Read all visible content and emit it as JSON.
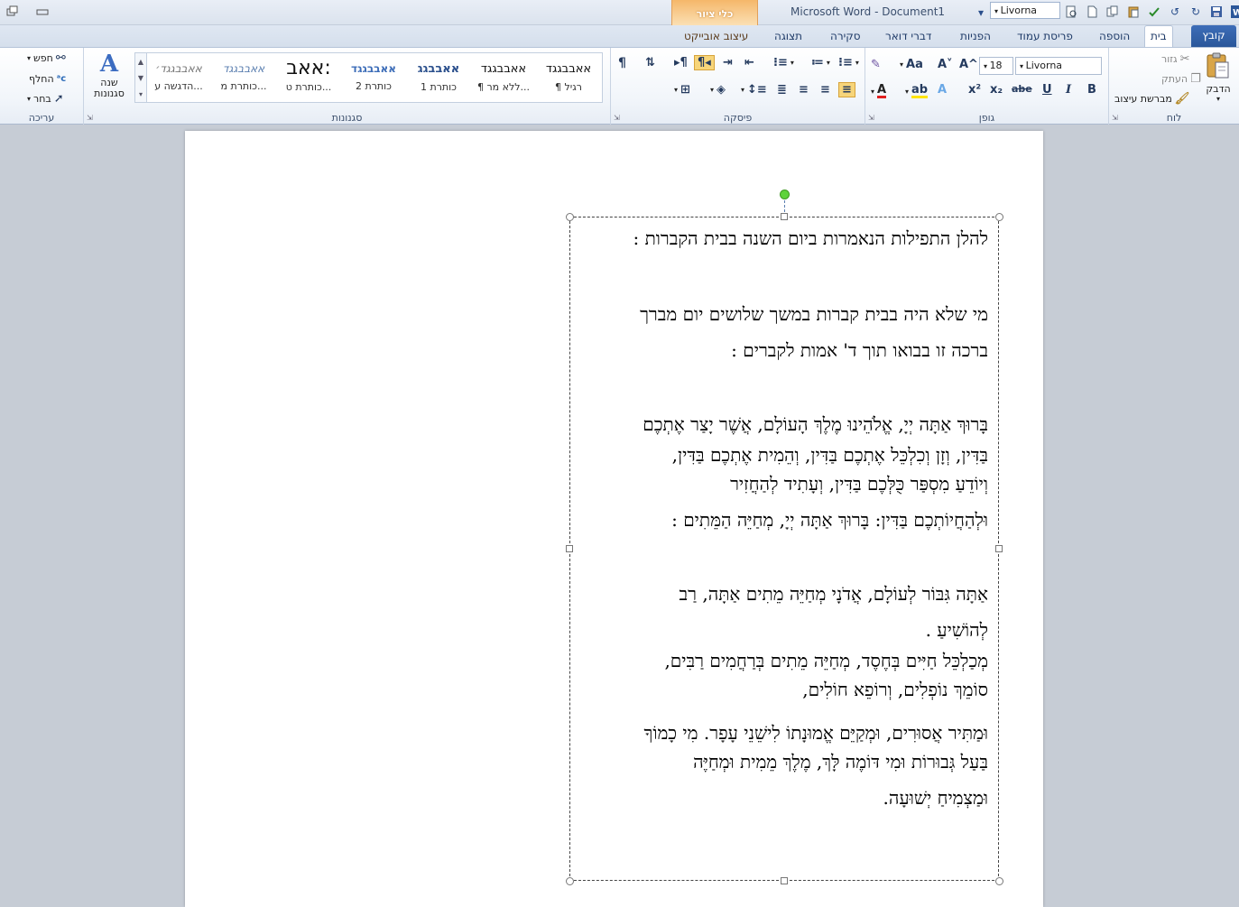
{
  "window": {
    "title": "Microsoft Word  -  Document1",
    "font_name_box": "Livorna",
    "contextual_tab_group": "כלי ציור"
  },
  "tabs": [
    {
      "label": "קובץ",
      "active": false
    },
    {
      "label": "בית",
      "active": true
    },
    {
      "label": "הוספה",
      "active": false
    },
    {
      "label": "פריסת עמוד",
      "active": false
    },
    {
      "label": "הפניות",
      "active": false
    },
    {
      "label": "דברי דואר",
      "active": false
    },
    {
      "label": "סקירה",
      "active": false
    },
    {
      "label": "תצוגה",
      "active": false
    },
    {
      "label": "עיצוב אובייקט",
      "active": false
    }
  ],
  "ribbon": {
    "clipboard": {
      "label": "לוח",
      "paste": "הדבק",
      "cut": "גזור",
      "copy": "העתק",
      "format_painter": "מברשת עיצוב"
    },
    "font": {
      "label": "גופן",
      "font_name": "Livorna",
      "font_size": "18",
      "bold": "B",
      "italic": "I",
      "underline": "U",
      "strike": "abe",
      "subscript": "x₂",
      "superscript": "x²",
      "font_color_letter": "A",
      "grow": "A^",
      "shrink": "A˅",
      "change_case": "Aa"
    },
    "paragraph": {
      "label": "פיסקה",
      "show_marks": "¶"
    },
    "styles": {
      "label": "סגנונות",
      "items": [
        {
          "sample": "אאבבגגד",
          "name": "¶ רגיל"
        },
        {
          "sample": "אאבבגגד",
          "name": "¶ ללא מר..."
        },
        {
          "sample": "אאבבגג",
          "name": "כותרת 1"
        },
        {
          "sample": "אאבבגגד",
          "name": "כותרת 2"
        },
        {
          "sample": "אאב:",
          "name": "כותרת ט..."
        },
        {
          "sample": "אאבבגגד",
          "name": "כותרת מ..."
        },
        {
          "sample": "אאבבגגד׳",
          "name": "הדגשה ע..."
        }
      ],
      "change_styles": "שנה סגנונות"
    },
    "editing": {
      "label": "עריכה",
      "find": "חפש",
      "replace": "החלף",
      "select": "בחר"
    }
  },
  "document": {
    "lines": [
      "להלן התפילות הנאמרות ביום השנה בבית הקברות :",
      "",
      "מי שלא היה בבית קברות במשך שלושים יום מברך",
      "ברכה זו בבואו תוך ד' אמות לקברים :",
      "",
      "בָּרוּךְ אַתָּה יְיָ, אֱלֹהֵינוּ מֶלֶךְ הָעוֹלָם, אֲשֶׁר יָצַר אֶתְכֶם",
      "בַּדִּין, וְזָן וְכִלְכֵּל אֶתְכֶם בַּדִּין, וְהֵמִית אֶתְכֶם בַּדִּין,",
      "וְיוֹדֵעַ מִסְפַּר כֻּלְּכֶם בַּדִּין, וְעָתִיד לְהַחֲזִיר",
      "וּלְהַחֲיוֹתְכֶם בַּדִּין: בָּרוּךְ אַתָּה יְיָ, מְחַיֵּה הַמֵּתִים  :",
      "",
      "אַתָּה גִּבּוֹר לְעוֹלָם, אֲדֹנָי מְחַיֵּה מֵתִים אַתָּה, רַב",
      "לְהוֹשִׁיעַ  .",
      "מְכַלְכֵּל חַיִּים בְּחֶסֶד, מְחַיֵּה מֵתִים בְּרַחֲמִים רַבִּים,",
      "סוֹמֵךְ נוֹפְלִים, וְרוֹפֵא חוֹלִים,",
      "וּמַתִּיר אֲסוּרִים, וּמְקַיֵּם אֱמוּנָתוֹ לִישֵׁנֵי עָפָר. מִי כָמוֹךָ",
      "בַּעַל גְּבוּרוֹת וּמִי דּוֹמֶה לָּךְ, מֶלֶךְ מֵמִית וּמְחַיֶּה",
      "וּמַצְמִיחַ יְשׁוּעָה."
    ]
  }
}
